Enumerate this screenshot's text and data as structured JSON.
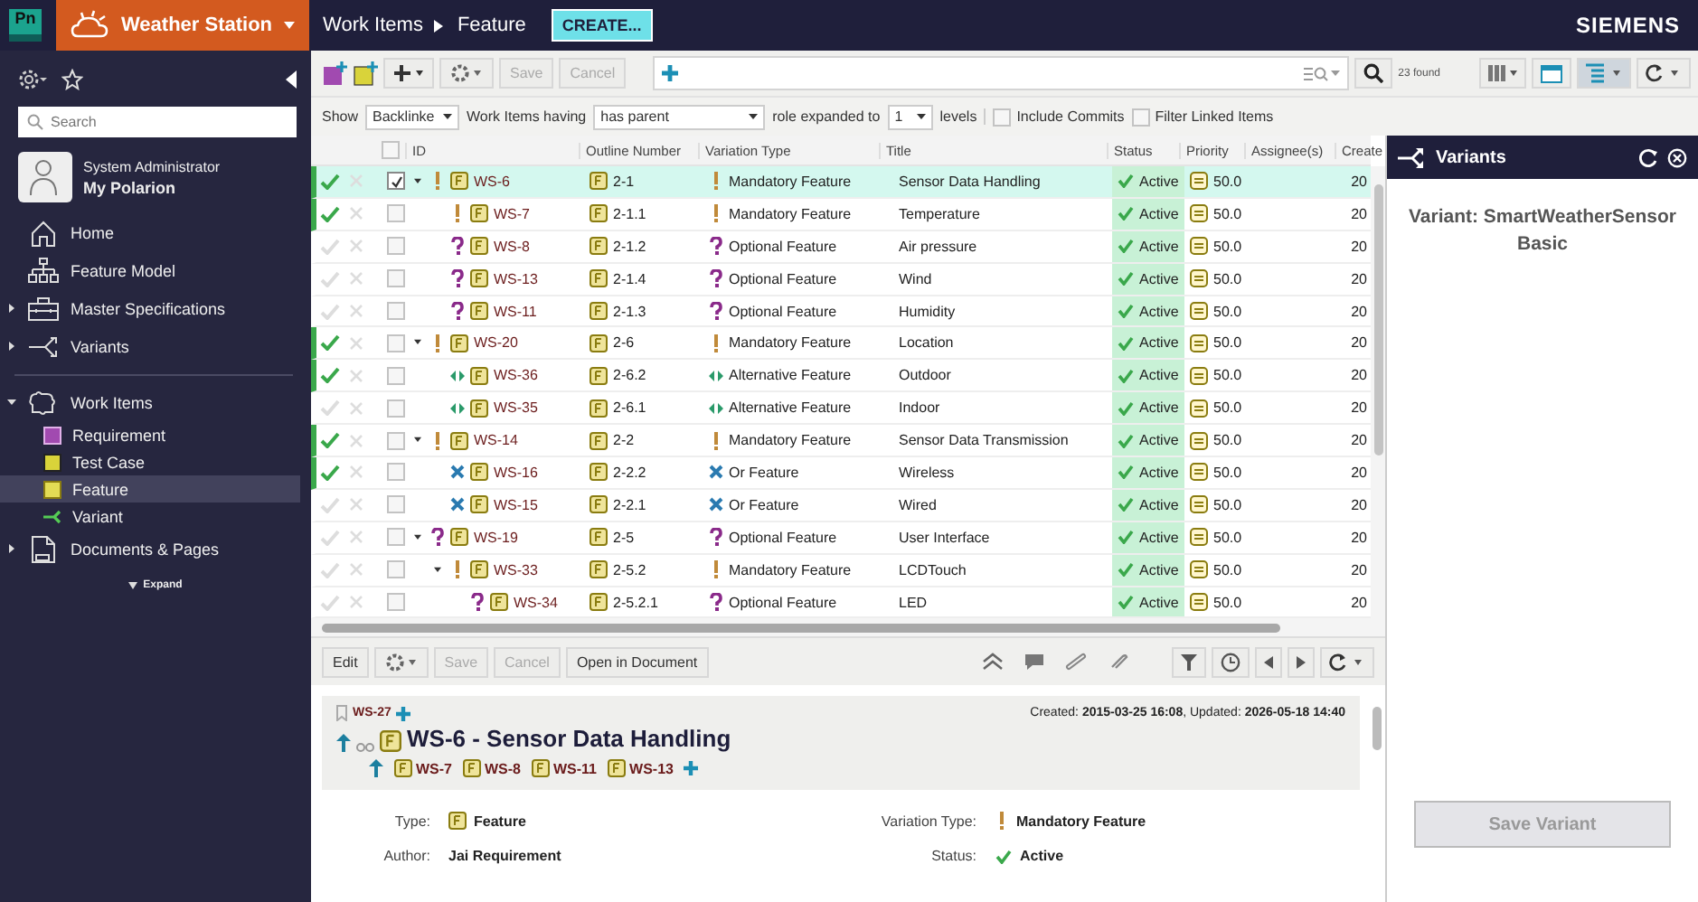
{
  "topbar": {
    "logo": "Pn",
    "project": "Weather Station",
    "breadcrumb": [
      "Work Items",
      "Feature"
    ],
    "create_button": "CREATE...",
    "brand": "SIEMENS"
  },
  "sidebar": {
    "search": {
      "placeholder": "Search"
    },
    "user": {
      "role": "System Administrator",
      "name": "My Polarion"
    },
    "nav_groups": [
      [
        {
          "kind": "home",
          "label": "Home",
          "selected": false
        },
        {
          "kind": "model",
          "label": "Feature Model",
          "selected": false
        },
        {
          "kind": "spec",
          "label": "Master Specifications",
          "selected": false,
          "expanded": false
        },
        {
          "kind": "variants",
          "label": "Variants",
          "selected": false,
          "expanded": false
        }
      ],
      [
        {
          "kind": "workitems",
          "label": "Work Items",
          "selected": false,
          "expanded": true,
          "children": [
            {
              "kind": "requirement",
              "label": "Requirement",
              "selected": false
            },
            {
              "kind": "testcase",
              "label": "Test Case",
              "selected": false
            },
            {
              "kind": "feature",
              "label": "Feature",
              "selected": true
            },
            {
              "kind": "variant",
              "label": "Variant",
              "selected": false
            }
          ]
        },
        {
          "kind": "documents",
          "label": "Documents & Pages",
          "selected": false,
          "expanded": false
        }
      ]
    ],
    "expand_link": "Expand"
  },
  "toolbar": {
    "buttons": [
      {
        "label": "Save",
        "disabled": true
      },
      {
        "label": "Cancel",
        "disabled": true
      }
    ],
    "found": "23 found"
  },
  "filter": {
    "show_label": "Show",
    "show_value": "Backlinke",
    "having_label": "Work Items having",
    "having_value": "has parent",
    "role_label": "role expanded to",
    "levels_value": "1",
    "levels_label": "levels",
    "options": [
      {
        "label": "Include Commits",
        "checked": false
      },
      {
        "label": "Filter Linked Items",
        "checked": false
      }
    ]
  },
  "table": {
    "all_checked": false,
    "columns": [
      "ID",
      "Outline Number",
      "Variation Type",
      "Title",
      "Status",
      "Priority",
      "Assignee(s)",
      "Create"
    ],
    "rows": [
      {
        "id": "WS-6",
        "outline": "2-1",
        "kind": "mandatory",
        "variation": "Mandatory Feature",
        "title": "Sensor Data Handling",
        "status": "Active",
        "priority": "50.0",
        "created": "20",
        "included": true,
        "checked": true,
        "selected": true,
        "expanded": true,
        "children": [
          {
            "id": "WS-7",
            "outline": "2-1.1",
            "kind": "mandatory",
            "variation": "Mandatory Feature",
            "title": "Temperature",
            "status": "Active",
            "priority": "50.0",
            "created": "20",
            "included": true,
            "checked": false,
            "selected": false
          },
          {
            "id": "WS-8",
            "outline": "2-1.2",
            "kind": "optional",
            "variation": "Optional Feature",
            "title": "Air pressure",
            "status": "Active",
            "priority": "50.0",
            "created": "20",
            "included": false,
            "checked": false,
            "selected": false
          },
          {
            "id": "WS-13",
            "outline": "2-1.4",
            "kind": "optional",
            "variation": "Optional Feature",
            "title": "Wind",
            "status": "Active",
            "priority": "50.0",
            "created": "20",
            "included": false,
            "checked": false,
            "selected": false
          },
          {
            "id": "WS-11",
            "outline": "2-1.3",
            "kind": "optional",
            "variation": "Optional Feature",
            "title": "Humidity",
            "status": "Active",
            "priority": "50.0",
            "created": "20",
            "included": false,
            "checked": false,
            "selected": false
          }
        ]
      },
      {
        "id": "WS-20",
        "outline": "2-6",
        "kind": "mandatory",
        "variation": "Mandatory Feature",
        "title": "Location",
        "status": "Active",
        "priority": "50.0",
        "created": "20",
        "included": true,
        "checked": false,
        "selected": false,
        "expanded": true,
        "children": [
          {
            "id": "WS-36",
            "outline": "2-6.2",
            "kind": "alternative",
            "variation": "Alternative Feature",
            "title": "Outdoor",
            "status": "Active",
            "priority": "50.0",
            "created": "20",
            "included": true,
            "checked": false,
            "selected": false
          },
          {
            "id": "WS-35",
            "outline": "2-6.1",
            "kind": "alternative",
            "variation": "Alternative Feature",
            "title": "Indoor",
            "status": "Active",
            "priority": "50.0",
            "created": "20",
            "included": false,
            "checked": false,
            "selected": false
          }
        ]
      },
      {
        "id": "WS-14",
        "outline": "2-2",
        "kind": "mandatory",
        "variation": "Mandatory Feature",
        "title": "Sensor Data Transmission",
        "status": "Active",
        "priority": "50.0",
        "created": "20",
        "included": true,
        "checked": false,
        "selected": false,
        "expanded": true,
        "children": [
          {
            "id": "WS-16",
            "outline": "2-2.2",
            "kind": "or",
            "variation": "Or Feature",
            "title": "Wireless",
            "status": "Active",
            "priority": "50.0",
            "created": "20",
            "included": true,
            "checked": false,
            "selected": false
          },
          {
            "id": "WS-15",
            "outline": "2-2.1",
            "kind": "or",
            "variation": "Or Feature",
            "title": "Wired",
            "status": "Active",
            "priority": "50.0",
            "created": "20",
            "included": false,
            "checked": false,
            "selected": false
          }
        ]
      },
      {
        "id": "WS-19",
        "outline": "2-5",
        "kind": "optional",
        "variation": "Optional Feature",
        "title": "User Interface",
        "status": "Active",
        "priority": "50.0",
        "created": "20",
        "included": false,
        "checked": false,
        "selected": false,
        "expanded": true,
        "children": [
          {
            "id": "WS-33",
            "outline": "2-5.2",
            "kind": "mandatory",
            "variation": "Mandatory Feature",
            "title": "LCDTouch",
            "status": "Active",
            "priority": "50.0",
            "created": "20",
            "included": false,
            "checked": false,
            "selected": false,
            "expanded": true,
            "children": [
              {
                "id": "WS-34",
                "outline": "2-5.2.1",
                "kind": "optional",
                "variation": "Optional Feature",
                "title": "LED",
                "status": "Active",
                "priority": "50.0",
                "created": "20",
                "included": false,
                "checked": false,
                "selected": false
              }
            ]
          }
        ]
      }
    ]
  },
  "detail": {
    "buttons": [
      {
        "label": "Edit",
        "disabled": false
      },
      {
        "label": "Save",
        "disabled": true
      },
      {
        "label": "Cancel",
        "disabled": true
      },
      {
        "label": "Open in Document",
        "disabled": false
      }
    ],
    "parent_id": "WS-27",
    "dates": "Created: **2015-03-25 16:08**, Updated: **2026-05-18 14:40**",
    "title": "WS-6 - Sensor Data Handling",
    "children": [
      "WS-7",
      "WS-8",
      "WS-11",
      "WS-13"
    ],
    "fields": [
      {
        "label": "Type:",
        "value": "Feature",
        "kind": "feature"
      },
      {
        "label": "Variation Type:",
        "value": "Mandatory Feature",
        "kind": "mandatory"
      },
      {
        "label": "Author:",
        "value": "Jai Requirement",
        "kind": "text"
      },
      {
        "label": "Status:",
        "value": "Active",
        "kind": "status"
      }
    ]
  },
  "variants_panel": {
    "title": "Variants",
    "variant": "Variant: SmartWeatherSensor Basic",
    "save_button": {
      "label": "Save Variant",
      "disabled": true
    }
  }
}
